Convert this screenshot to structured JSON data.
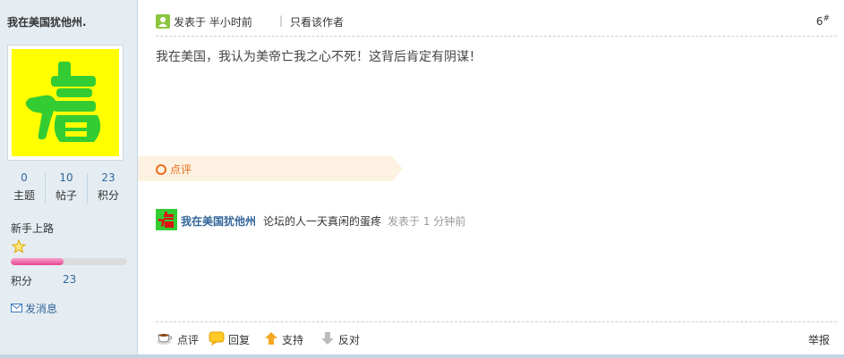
{
  "user": {
    "name": "我在美国犹他州.",
    "stats": [
      {
        "value": "0",
        "label": "主题"
      },
      {
        "value": "10",
        "label": "帖子"
      },
      {
        "value": "23",
        "label": "积分"
      }
    ],
    "group": "新手上路",
    "progress": 0.45,
    "points_label": "积分",
    "points_value": "23",
    "pm_label": "发消息"
  },
  "post": {
    "time": "发表于 半小时前",
    "separator": "|",
    "author_only": "只看该作者",
    "floor_number": "6",
    "floor_suffix": "#",
    "content": "我在美国，我认为美帝亡我之心不死！这背后肯定有阴谋！",
    "comment_tag": "点评",
    "comment": {
      "user": "我在美国犹他州",
      "text": "论坛的人一天真闲的蛋疼",
      "time": "发表于 1 分钟前"
    },
    "actions": {
      "comment": "点评",
      "reply": "回复",
      "support": "支持",
      "oppose": "反对",
      "report": "举报"
    }
  },
  "colors": {
    "sidebar_bg": "#e5edf2",
    "link": "#336699",
    "comment_orange": "#e86d1d",
    "avatar_yellow": "#ffff00",
    "avatar_green": "#33cc33"
  }
}
